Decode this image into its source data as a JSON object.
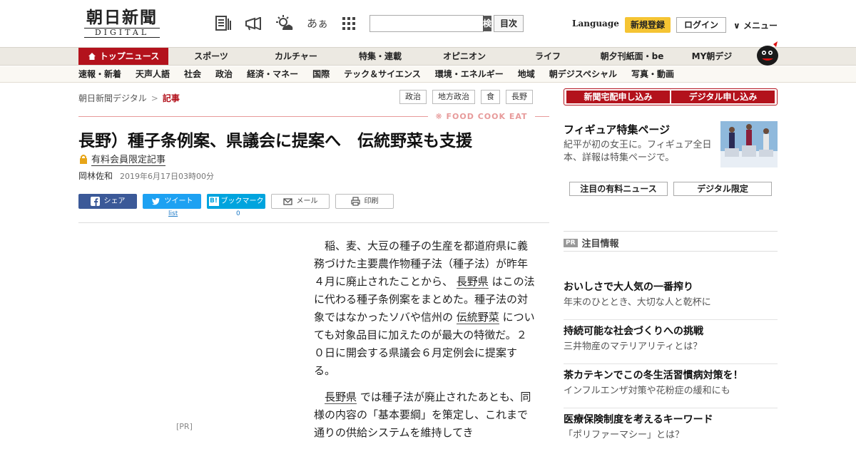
{
  "header": {
    "logo_main": "朝日新聞",
    "logo_sub": "DIGITAL",
    "search_placeholder": "",
    "search_button": "検 索",
    "toc_button": "目次",
    "language": "Language",
    "signup": "新規登録",
    "login": "ログイン",
    "menu": "メニュー",
    "icons": [
      "news-list-icon",
      "megaphone-icon",
      "weather-icon",
      "font-size-icon",
      "grid-icon"
    ],
    "font_icon_text": "あぁ"
  },
  "nav1": [
    {
      "label": "トップニュース",
      "active": true
    },
    {
      "label": "スポーツ"
    },
    {
      "label": "カルチャー"
    },
    {
      "label": "特集・連載"
    },
    {
      "label": "オピニオン"
    },
    {
      "label": "ライフ"
    },
    {
      "label": "朝夕刊紙面・be"
    },
    {
      "label": "MY朝デジ"
    }
  ],
  "nav2": [
    "速報・新着",
    "天声人語",
    "社会",
    "政治",
    "経済・マネー",
    "国際",
    "テック＆サイエンス",
    "環境・エネルギー",
    "地域",
    "朝デジスペシャル",
    "写真・動画"
  ],
  "breadcrumb": {
    "home": "朝日新聞デジタル",
    "sep": ">",
    "current": "記事"
  },
  "tags": [
    "政治",
    "地方政治",
    "食",
    "長野"
  ],
  "food_label": "FOOD COOK EAT",
  "article": {
    "title": "長野）種子条例案、県議会に提案へ　伝統野菜も支援",
    "premium": "有料会員限定記事",
    "author": "岡林佐和",
    "date": "2019年6月17日03時00分",
    "share": {
      "facebook": "シェア",
      "twitter": "ツイート",
      "hatena": "ブックマーク",
      "mail": "メール",
      "print": "印刷"
    },
    "twitter_count": "list",
    "hatena_count": "0",
    "p1_a": "稲、麦、大豆の種子の生産を都道府県に義務づけた主要農作物種子法（種子法）が昨年４月に廃止されたことから、",
    "p1_link1": "長野県",
    "p1_b": "はこの法に代わる種子条例案をまとめた。種子法の対象ではなかったソバや信州の",
    "p1_link2": "伝統野菜",
    "p1_c": "についても対象品目に加えたのが最大の特徴だ。２０日に開会する県議会６月定例会に提案する。",
    "p2_link": "長野県",
    "p2_a": "では種子法が廃止されたあとも、同様の内容の「基本要綱」を策定し、これまで通りの供給システムを維持してき"
  },
  "pr_left": "[PR]",
  "sidebar": {
    "subscribe_paper": "新聞宅配申し込み",
    "subscribe_digital": "デジタル申し込み",
    "feature_title": "フィギュア特集ページ",
    "feature_desc": "紀平が初の女王に。フィギュア全日本、詳報は特集ページで。",
    "tab_premium": "注目の有料ニュース",
    "tab_digital": "デジタル限定",
    "pr_badge": "PR",
    "pr_heading": "注目情報",
    "pr_items": [
      {
        "title": "おいしさで大人気の一番搾り",
        "sub": "年末のひととき、大切な人と乾杯に"
      },
      {
        "title": "持続可能な社会づくりへの挑戦",
        "sub": "三井物産のマテリアリティとは？"
      },
      {
        "title": "茶カテキンでこの冬生活習慣病対策を！",
        "sub": "インフルエンザ対策や花粉症の緩和にも"
      },
      {
        "title": "医療保険制度を考えるキーワード",
        "sub": "「ポリファーマシー」とは？"
      }
    ]
  },
  "colors": {
    "brand_red": "#b3121c",
    "signup_yellow": "#f5c433"
  }
}
